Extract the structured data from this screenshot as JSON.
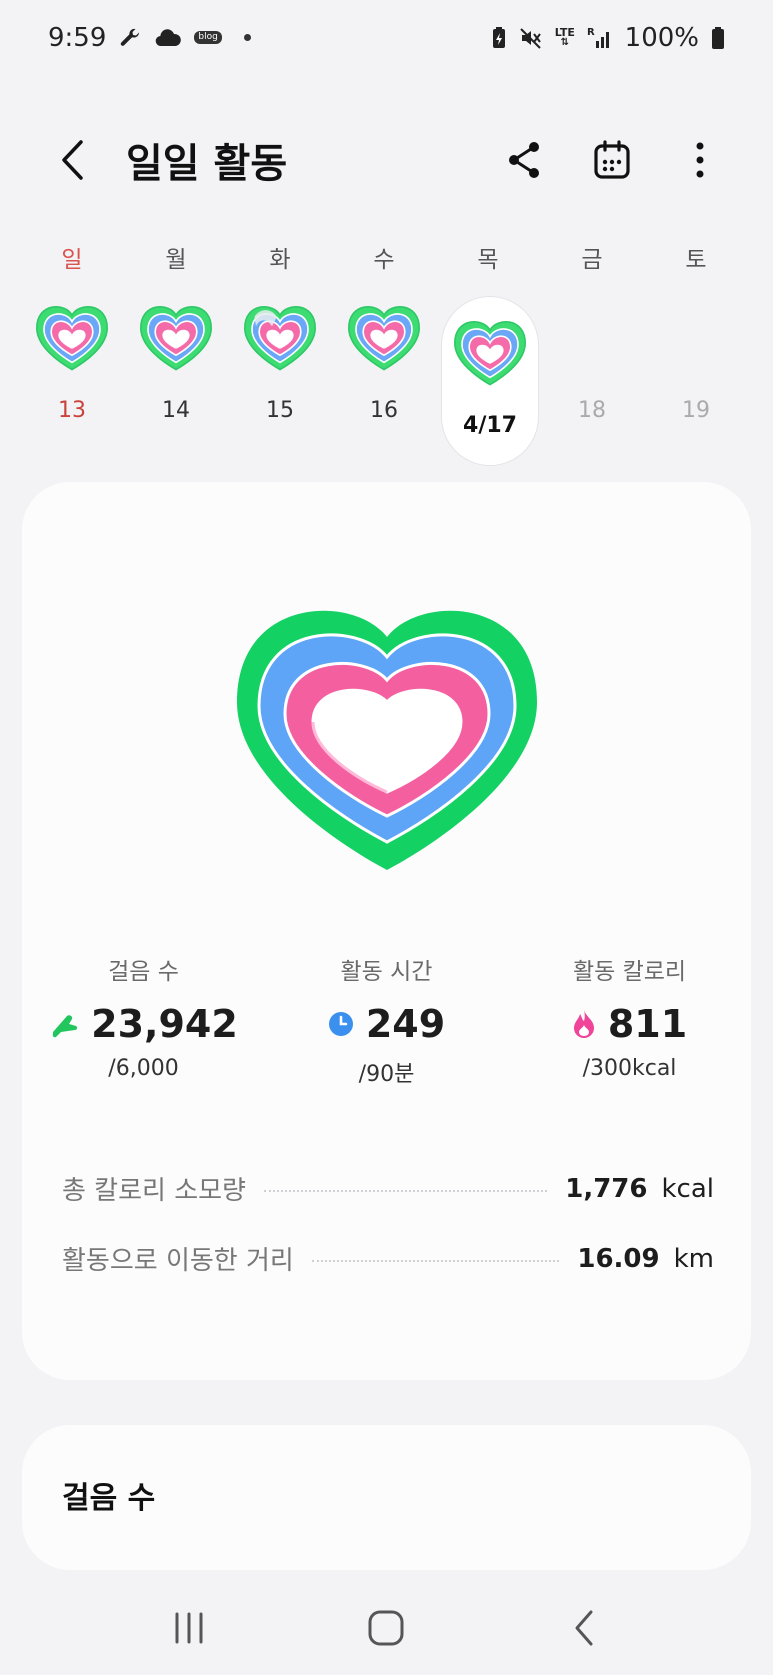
{
  "status_bar": {
    "time": "9:59",
    "blog_badge": "blog",
    "network": "LTE",
    "network_sub": "R",
    "battery": "100%"
  },
  "header": {
    "title": "일일 활동"
  },
  "week": [
    {
      "label": "일",
      "date": "13",
      "has_heart": true
    },
    {
      "label": "월",
      "date": "14",
      "has_heart": true
    },
    {
      "label": "화",
      "date": "15",
      "has_heart": true
    },
    {
      "label": "수",
      "date": "16",
      "has_heart": true
    },
    {
      "label": "목",
      "date": "4/17",
      "has_heart": true
    },
    {
      "label": "금",
      "date": "18",
      "has_heart": false
    },
    {
      "label": "토",
      "date": "19",
      "has_heart": false
    }
  ],
  "summary": {
    "stats": [
      {
        "label": "걸음 수",
        "value": "23,942",
        "goal": "/6,000",
        "icon": "shoe-icon",
        "color": "#22c55e"
      },
      {
        "label": "활동 시간",
        "value": "249",
        "goal": "/90분",
        "icon": "clock-icon",
        "color": "#3b82f6"
      },
      {
        "label": "활동 칼로리",
        "value": "811",
        "goal": "/300kcal",
        "icon": "flame-icon",
        "color": "#ec4899"
      }
    ],
    "details": [
      {
        "label": "총 칼로리 소모량",
        "value": "1,776",
        "unit": "kcal"
      },
      {
        "label": "활동으로 이동한 거리",
        "value": "16.09",
        "unit": "km"
      }
    ]
  },
  "steps_card": {
    "title": "걸음 수"
  },
  "colors": {
    "ring_outer": "#1ed760",
    "ring_middle": "#5aa0f5",
    "ring_inner": "#f45fa5",
    "sunday": "#d9534f"
  }
}
